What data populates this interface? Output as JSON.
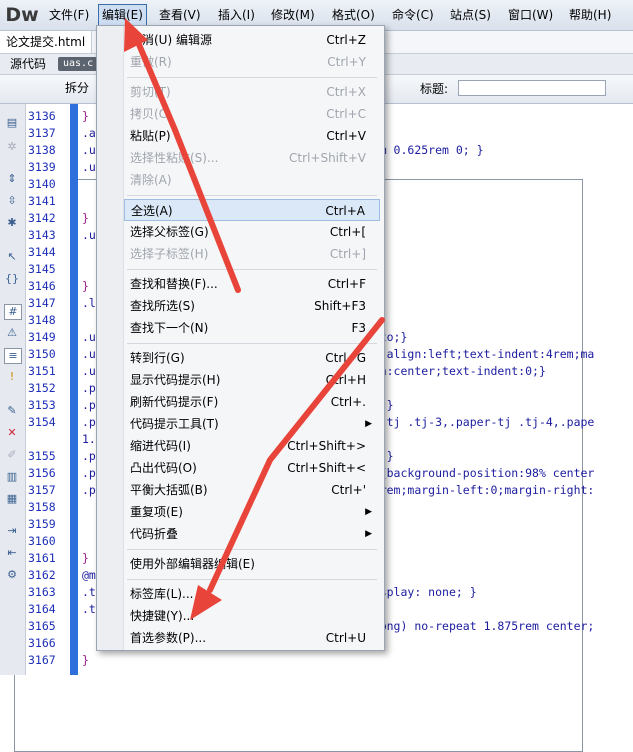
{
  "app": {
    "logo": "Dw"
  },
  "menubar": [
    "文件(F)",
    "编辑(E)",
    "查看(V)",
    "插入(I)",
    "修改(M)",
    "格式(O)",
    "命令(C)",
    "站点(S)",
    "窗口(W)",
    "帮助(H)"
  ],
  "doc_tab": "论文提交.html",
  "related": {
    "source": "源代码",
    "file": "uas.c"
  },
  "toolbar": {
    "code": "代码",
    "split": "拆分",
    "title_label": "标题:"
  },
  "line_numbers": [
    "3136",
    "3137",
    "3138",
    "3139",
    "3140",
    "3141",
    "3142",
    "3143",
    "3144",
    "3145",
    "3146",
    "3147",
    "3148",
    "3149",
    "3150",
    "3151",
    "3152",
    "3153",
    "3154",
    "",
    "3155",
    "3156",
    "3157",
    "3158",
    "3159",
    "3160",
    "3161",
    "3162",
    "3163",
    "3164",
    "3165",
    "3166",
    "3167"
  ],
  "code_lines": [
    "}",
    ".a",
    ".u                                         m 0.625rem 0; }",
    ".u",
    "",
    "",
    "}",
    ".u",
    "",
    "",
    "}",
    ".l",
    "",
    ".u                                         to;}",
    ".u                                         -align:left;text-indent:4rem;ma",
    ".u                                         n:center;text-indent:0;}",
    ".p",
    ".p                                         ;}",
    ".p                                         -tj .tj-3,.paper-tj .tj-4,.pape",
    "1.",
    ".p                                         ;}",
    ".p                                         {background-position:98% center",
    ".p                                         rem;margin-left:0;margin-right:",
    "",
    "",
    "",
    "}",
    "@m",
    ".t                                         splay: none; }",
    ".t",
    "                                           png) no-repeat 1.875rem center;",
    "",
    "}"
  ],
  "edit_menu": [
    {
      "label": "撤消(U) 编辑源",
      "shortcut": "Ctrl+Z",
      "disabled": false
    },
    {
      "label": "重做(R)",
      "shortcut": "Ctrl+Y",
      "disabled": true
    },
    {
      "sep": true
    },
    {
      "label": "剪切(T)",
      "shortcut": "Ctrl+X",
      "disabled": true
    },
    {
      "label": "拷贝(C)",
      "shortcut": "Ctrl+C",
      "disabled": true
    },
    {
      "label": "粘贴(P)",
      "shortcut": "Ctrl+V",
      "disabled": false
    },
    {
      "label": "选择性粘贴(S)...",
      "shortcut": "Ctrl+Shift+V",
      "disabled": true
    },
    {
      "label": "清除(A)",
      "shortcut": "",
      "disabled": true
    },
    {
      "sep": true
    },
    {
      "label": "全选(A)",
      "shortcut": "Ctrl+A",
      "disabled": false,
      "highlight": true
    },
    {
      "label": "选择父标签(G)",
      "shortcut": "Ctrl+[",
      "disabled": false
    },
    {
      "label": "选择子标签(H)",
      "shortcut": "Ctrl+]",
      "disabled": true
    },
    {
      "sep": true
    },
    {
      "label": "查找和替换(F)...",
      "shortcut": "Ctrl+F",
      "disabled": false
    },
    {
      "label": "查找所选(S)",
      "shortcut": "Shift+F3",
      "disabled": false
    },
    {
      "label": "查找下一个(N)",
      "shortcut": "F3",
      "disabled": false
    },
    {
      "sep": true
    },
    {
      "label": "转到行(G)",
      "shortcut": "Ctrl+G",
      "disabled": false
    },
    {
      "label": "显示代码提示(H)",
      "shortcut": "Ctrl+H",
      "disabled": false
    },
    {
      "label": "刷新代码提示(F)",
      "shortcut": "Ctrl+.",
      "disabled": false
    },
    {
      "label": "代码提示工具(T)",
      "shortcut": "",
      "disabled": false,
      "submenu": true
    },
    {
      "label": "缩进代码(I)",
      "shortcut": "Ctrl+Shift+>",
      "disabled": false
    },
    {
      "label": "凸出代码(O)",
      "shortcut": "Ctrl+Shift+<",
      "disabled": false
    },
    {
      "label": "平衡大括弧(B)",
      "shortcut": "Ctrl+'",
      "disabled": false
    },
    {
      "label": "重复项(E)",
      "shortcut": "",
      "disabled": false,
      "submenu": true
    },
    {
      "label": "代码折叠",
      "shortcut": "",
      "disabled": false,
      "submenu": true
    },
    {
      "sep": true
    },
    {
      "label": "使用外部编辑器编辑(E)",
      "shortcut": "",
      "disabled": false
    },
    {
      "sep": true
    },
    {
      "label": "标签库(L)...",
      "shortcut": "",
      "disabled": false
    },
    {
      "label": "快捷键(Y)...",
      "shortcut": "",
      "disabled": false
    },
    {
      "label": "首选参数(P)...",
      "shortcut": "Ctrl+U",
      "disabled": false
    }
  ],
  "annotation_color": "#e8443a"
}
